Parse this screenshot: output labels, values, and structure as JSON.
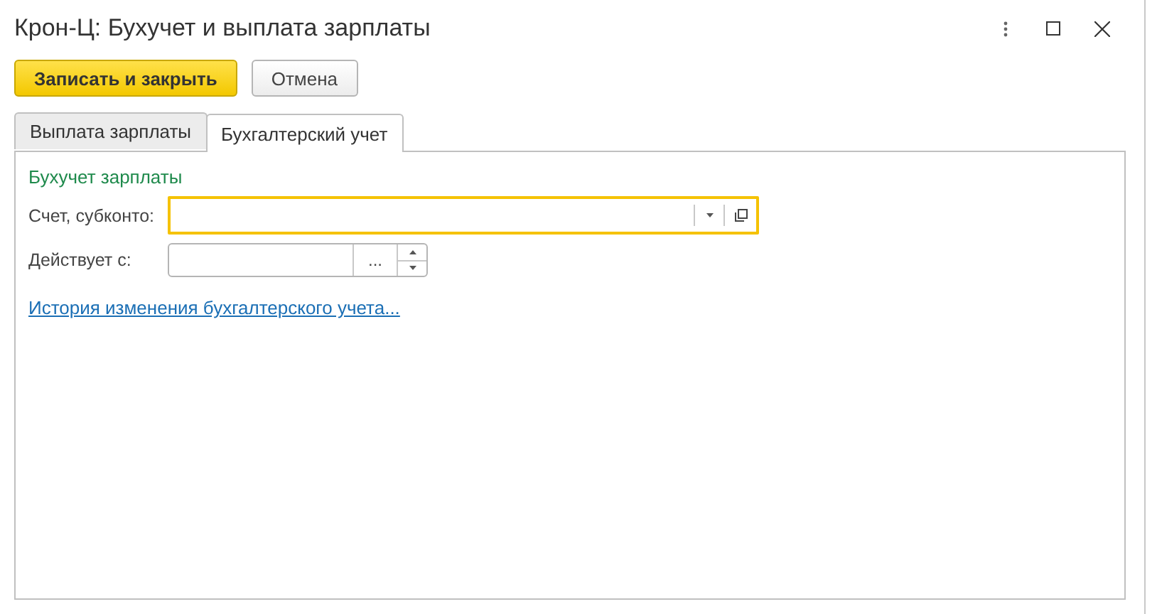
{
  "window": {
    "title": "Крон-Ц: Бухучет и выплата зарплаты"
  },
  "toolbar": {
    "buttons": [
      {
        "label": "Записать и закрыть",
        "kind": "primary"
      },
      {
        "label": "Отмена",
        "kind": "normal"
      }
    ]
  },
  "tabs": [
    {
      "label": "Выплата зарплаты",
      "selected": false
    },
    {
      "label": "Бухгалтерский учет",
      "selected": true
    }
  ],
  "group": {
    "title": "Бухучет зарплаты"
  },
  "fields": [
    {
      "label": "Счет, субконто:",
      "kind": "select",
      "focused": true
    },
    {
      "label": "Действует с:",
      "kind": "date",
      "button_text": "..."
    }
  ],
  "link": "История изменения бухгалтерского учета..."
}
